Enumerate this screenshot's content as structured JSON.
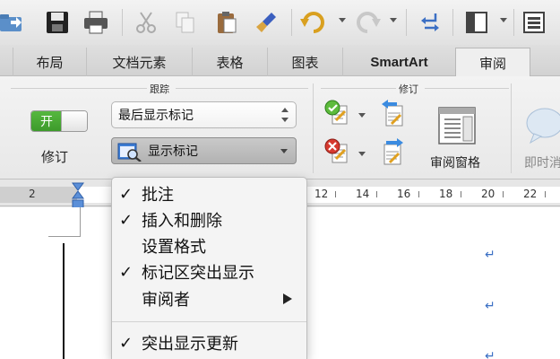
{
  "toolbar": {
    "buttons": [
      {
        "name": "open",
        "icon": "open-folder-icon"
      },
      {
        "name": "save",
        "icon": "floppy-save-icon"
      },
      {
        "name": "print",
        "icon": "printer-icon"
      },
      {
        "name": "cut",
        "icon": "scissors-cut-icon"
      },
      {
        "name": "copy",
        "icon": "copy-icon"
      },
      {
        "name": "paste",
        "icon": "clipboard-paste-icon"
      },
      {
        "name": "format-painter",
        "icon": "paintbrush-icon"
      },
      {
        "name": "undo",
        "icon": "undo-icon"
      },
      {
        "name": "redo",
        "icon": "redo-icon"
      },
      {
        "name": "show-formatting",
        "icon": "arrows-icon"
      },
      {
        "name": "sidebar-view",
        "icon": "sidebar-icon"
      },
      {
        "name": "gallery-view",
        "icon": "gallery-icon"
      }
    ]
  },
  "tabs": [
    {
      "label": "布局",
      "active": false
    },
    {
      "label": "文档元素",
      "active": false
    },
    {
      "label": "表格",
      "active": false
    },
    {
      "label": "图表",
      "active": false
    },
    {
      "label": "SmartArt",
      "active": false
    },
    {
      "label": "审阅",
      "active": true
    }
  ],
  "ribbon": {
    "tracking_group_label": "跟踪",
    "revisions_group_label": "修订",
    "toggle_on_label": "开",
    "track_changes_label": "修订",
    "display_select_value": "最后显示标记",
    "show_markup_label": "显示标记",
    "review_pane_label": "审阅窗格",
    "instant_label": "即时消"
  },
  "ruler": {
    "labels": [
      "2",
      "12",
      "14",
      "16",
      "18",
      "20",
      "22"
    ]
  },
  "menu": {
    "items": [
      {
        "label": "批注",
        "checked": true,
        "check": "✓",
        "submenu": false
      },
      {
        "label": "插入和删除",
        "checked": true,
        "check": "✓",
        "submenu": false
      },
      {
        "label": "设置格式",
        "checked": false,
        "check": "",
        "submenu": false
      },
      {
        "label": "标记区突出显示",
        "checked": true,
        "check": "✓",
        "submenu": false
      },
      {
        "label": "审阅者",
        "checked": false,
        "check": "",
        "submenu": true
      },
      {
        "label": "突出显示更新",
        "checked": true,
        "check": "✓",
        "submenu": false
      }
    ]
  },
  "document": {
    "paragraph_mark": "↵"
  },
  "colors": {
    "toggle_green": "#4caf35",
    "paragraph_mark_blue": "#3a6fc4",
    "active_tab_bg": "#efefef"
  }
}
